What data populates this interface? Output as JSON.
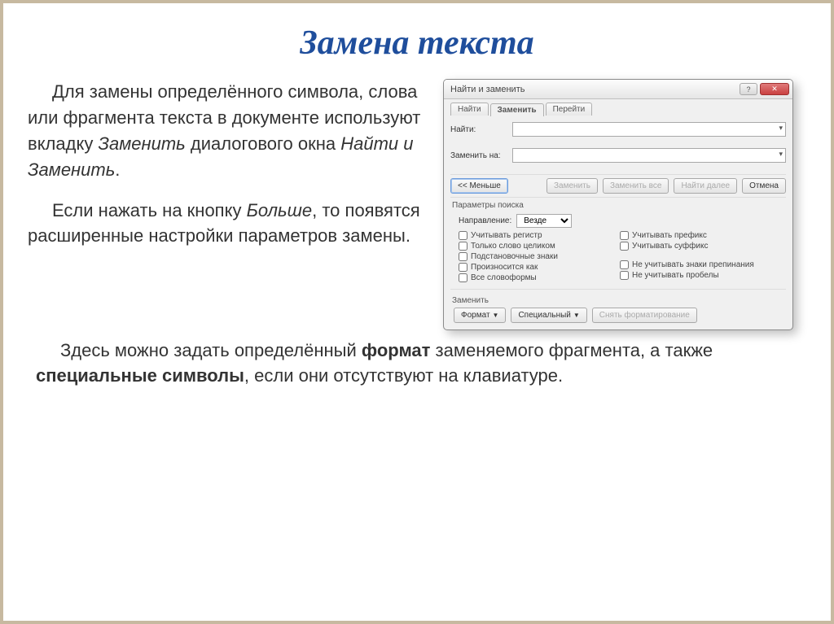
{
  "title": "Замена текста",
  "para1_a": "Для замены определённого символа, слова или фрагмента текста в документе используют вкладку ",
  "para1_i1": "Заменить",
  "para1_b": " диалогового окна ",
  "para1_i2": "Найти и Заменить",
  "para1_c": ".",
  "para2_a": "Если нажать на кнопку ",
  "para2_i1": "Больше",
  "para2_b": ", то появятся расширенные настройки параметров замены.",
  "bottom_a": "Здесь можно задать определённый ",
  "bottom_b1": "формат",
  "bottom_c": " заменяемого фрагмента, а также ",
  "bottom_b2": "специальные символы",
  "bottom_d": ", если они отсутствуют на клавиатуре.",
  "dialog": {
    "title": "Найти и заменить",
    "tabs": {
      "find": "Найти",
      "replace": "Заменить",
      "goto": "Перейти"
    },
    "find_label": "Найти:",
    "replace_label": "Заменить на:",
    "less_btn": "<< Меньше",
    "replace_btn": "Заменить",
    "replace_all_btn": "Заменить все",
    "find_next_btn": "Найти далее",
    "cancel_btn": "Отмена",
    "params_label": "Параметры поиска",
    "direction_label": "Направление:",
    "direction_value": "Везде",
    "checks_left": [
      "Учитывать регистр",
      "Только слово целиком",
      "Подстановочные знаки",
      "Произносится как",
      "Все словоформы"
    ],
    "checks_right": [
      "Учитывать префикс",
      "Учитывать суффикс",
      "Не учитывать знаки препинания",
      "Не учитывать пробелы"
    ],
    "section_replace": "Заменить",
    "format_btn": "Формат",
    "special_btn": "Специальный",
    "noformat_btn": "Снять форматирование"
  }
}
